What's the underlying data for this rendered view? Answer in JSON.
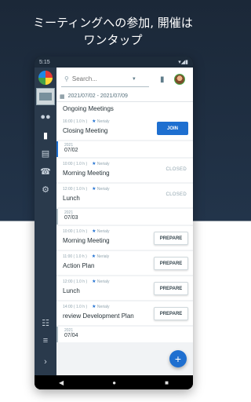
{
  "promo": {
    "line1": "ミーティングへの参加, 開催は",
    "line2": "ワンタップ"
  },
  "statusbar": {
    "time": "5:15",
    "signal": "▾◢▮"
  },
  "search": {
    "placeholder": "Search..."
  },
  "date_range": "2021/07/02 - 2021/07/09",
  "ongoing": {
    "title": "Ongoing Meetings",
    "meeting": {
      "time": "16:00 ( 1.0 h )",
      "host": "Nerialy",
      "title": "Closing Meeting",
      "action": "JOIN"
    }
  },
  "days": [
    {
      "year": "2021",
      "date": "07/02",
      "accent": true,
      "meetings": [
        {
          "time": "10:00 ( 1.0 h )",
          "host": "Nerialy",
          "title": "Morning Meeting",
          "status": "CLOSED"
        },
        {
          "time": "12:00 ( 1.0 h )",
          "host": "Nerialy",
          "title": "Lunch",
          "status": "CLOSED"
        }
      ]
    },
    {
      "year": "2021",
      "date": "07/03",
      "accent": false,
      "meetings": [
        {
          "time": "10:00 ( 1.0 h )",
          "host": "Nerialy",
          "title": "Morning Meeting",
          "action": "PREPARE"
        },
        {
          "time": "11:00 ( 1.0 h )",
          "host": "Nerialy",
          "title": "Action Plan",
          "action": "PREPARE"
        },
        {
          "time": "12:00 ( 1.0 h )",
          "host": "Nerialy",
          "title": "Lunch",
          "action": "PREPARE"
        },
        {
          "time": "14:00 ( 1.0 h )",
          "host": "Nerialy",
          "title": "review Development Plan",
          "action": "PREPARE"
        }
      ]
    },
    {
      "year": "2021",
      "date": "07/04",
      "accent": false,
      "meetings": []
    }
  ],
  "fab_label": "+",
  "nav": {
    "back": "◀",
    "home": "●",
    "recents": "■"
  },
  "colors": {
    "primary": "#1e6fd0",
    "rail": "#2a3a4c",
    "bg_dark": "#1b2838"
  }
}
